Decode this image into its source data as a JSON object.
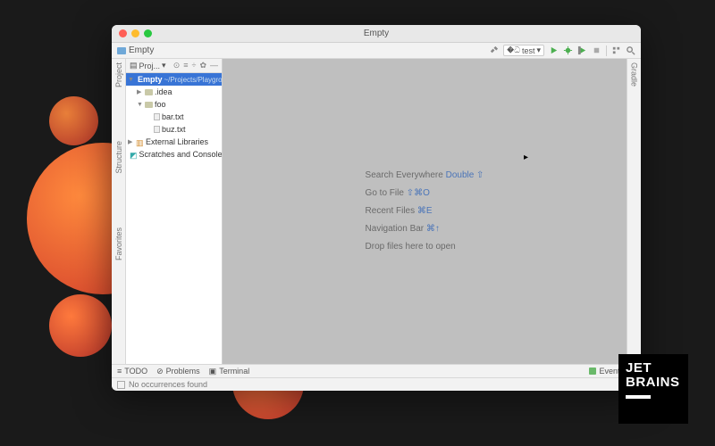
{
  "window": {
    "title": "Empty"
  },
  "navbar": {
    "project": "Empty"
  },
  "toolbar": {
    "run_config": "test"
  },
  "sidebar": {
    "header": "Proj...",
    "root": {
      "name": "Empty",
      "path": "~/Projects/Playgrou"
    },
    "idea": ".idea",
    "foo": "foo",
    "bar": "bar.txt",
    "buz": "buz.txt",
    "external": "External Libraries",
    "scratches": "Scratches and Consoles"
  },
  "left_gutter": {
    "project": "Project",
    "structure": "Structure",
    "favorites": "Favorites"
  },
  "right_gutter": {
    "gradle": "Gradle"
  },
  "hints": {
    "search_label": "Search Everywhere ",
    "search_key": "Double ⇧",
    "gotofile_label": "Go to File ",
    "gotofile_key": "⇧⌘O",
    "recent_label": "Recent Files ",
    "recent_key": "⌘E",
    "navbar_label": "Navigation Bar ",
    "navbar_key": "⌘↑",
    "drop": "Drop files here to open"
  },
  "bottom": {
    "todo": "TODO",
    "problems": "Problems",
    "terminal": "Terminal",
    "eventlog": "Event Log"
  },
  "status": {
    "text": "No occurrences found"
  },
  "brand": {
    "line1": "JET",
    "line2": "BRAINS"
  }
}
